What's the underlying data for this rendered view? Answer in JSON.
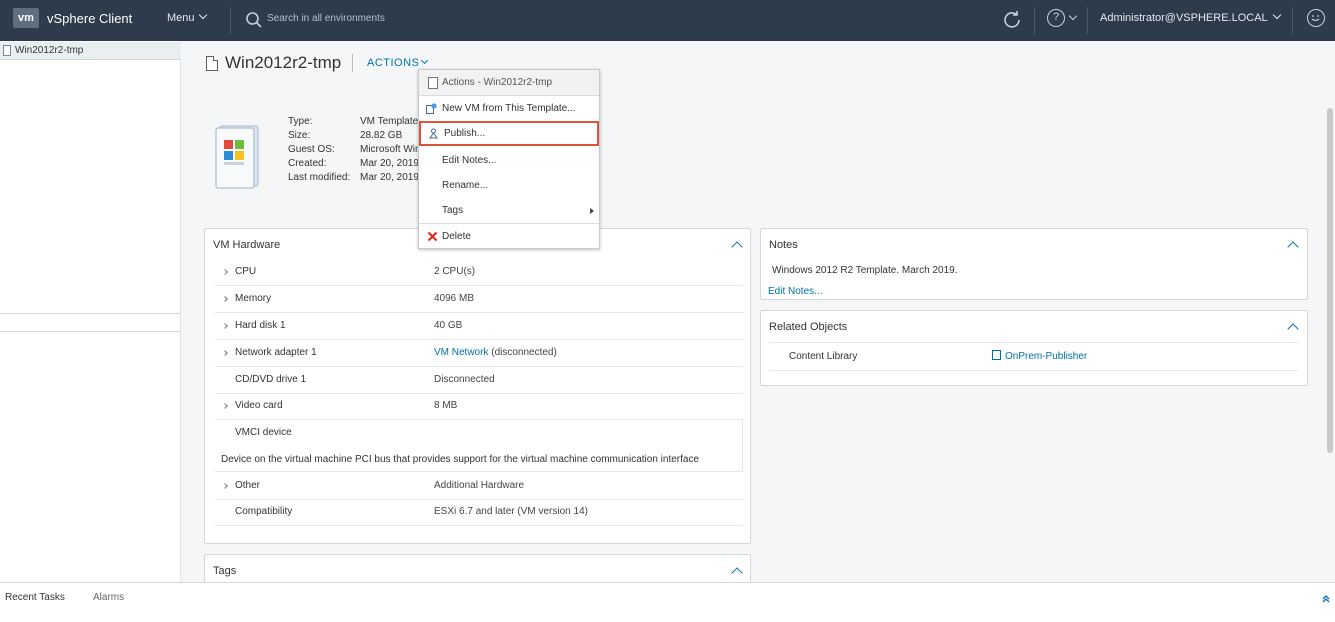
{
  "header": {
    "logo": "vm",
    "app_title": "vSphere Client",
    "menu_label": "Menu",
    "search_placeholder": "Search in all environments",
    "user": "Administrator@VSPHERE.LOCAL"
  },
  "navigator": {
    "selected_item": "Win2012r2-tmp"
  },
  "object": {
    "title": "Win2012r2-tmp",
    "actions_label": "ACTIONS"
  },
  "summary": {
    "rows": [
      {
        "label": "Type:",
        "value": "VM Template"
      },
      {
        "label": "Size:",
        "value": "28.82 GB"
      },
      {
        "label": "Guest OS:",
        "value": "Microsoft Windows Server 2012"
      },
      {
        "label": "Created:",
        "value": "Mar 20, 2019"
      },
      {
        "label": "Last modified:",
        "value": "Mar 20, 2019"
      }
    ]
  },
  "actions_menu": {
    "header": "Actions - Win2012r2-tmp",
    "items": [
      {
        "label": "New VM from This Template..."
      },
      {
        "label": "Publish..."
      },
      {
        "label": "Edit Notes..."
      },
      {
        "label": "Rename..."
      },
      {
        "label": "Tags"
      },
      {
        "label": "Delete"
      }
    ],
    "highlight_color": "#e0533c"
  },
  "hardware": {
    "title": "VM Hardware",
    "rows": [
      {
        "name": "CPU",
        "value": "2 CPU(s)"
      },
      {
        "name": "Memory",
        "value": "4096 MB"
      },
      {
        "name": "Hard disk 1",
        "value": "40 GB"
      },
      {
        "name": "Network adapter 1",
        "link": "VM Network",
        "value": "(disconnected)"
      },
      {
        "name": "CD/DVD drive 1",
        "value": "Disconnected"
      },
      {
        "name": "Video card",
        "value": "8 MB"
      },
      {
        "name": "VMCI device",
        "description": "Device on the virtual machine PCI bus that provides support for the virtual machine communication interface"
      },
      {
        "name": "Other",
        "value": "Additional Hardware"
      },
      {
        "name": "Compatibility",
        "value": "ESXi 6.7 and later (VM version 14)"
      }
    ]
  },
  "notes": {
    "title": "Notes",
    "text": "Windows 2012 R2 Template. March 2019.",
    "edit_link": "Edit Notes..."
  },
  "related": {
    "title": "Related Objects",
    "row_label": "Content Library",
    "row_value": "OnPrem-Publisher"
  },
  "tags_panel": {
    "title": "Tags"
  },
  "bottom": {
    "recent_tasks": "Recent Tasks",
    "alarms": "Alarms"
  },
  "colors": {
    "header_bg": "#2e3b4c",
    "link": "#0072a3"
  }
}
